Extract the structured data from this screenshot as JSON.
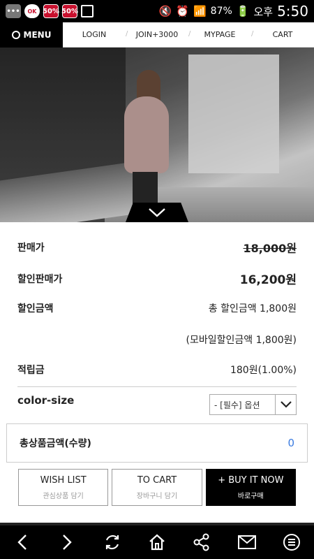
{
  "status_bar": {
    "icons": [
      "message-icon",
      "ok-app-icon",
      "sale-badge-icon",
      "sale-badge-icon",
      "clipboard-check-icon"
    ],
    "ok_label": "OK",
    "sale1": "50%",
    "sale2": "50%",
    "battery": "87%",
    "ampm": "오후",
    "time": "5:50"
  },
  "nav": {
    "menu": "MENU",
    "links": [
      "LOGIN",
      "JOIN+3000",
      "MYPAGE",
      "CART"
    ]
  },
  "product": {
    "rows": [
      {
        "label": "판매가",
        "value": "18,000원"
      },
      {
        "label": "할인판매가",
        "value": "16,200원"
      },
      {
        "label": "할인금액",
        "value": "총 할인금액 1,800원"
      },
      {
        "label": "",
        "value": "(모바일할인금액 1,800원)"
      },
      {
        "label": "적립금",
        "value": "180원(1.00%)"
      }
    ],
    "option_label": "color-size",
    "option_selected": "- [필수] 옵션",
    "total_label": "총상품금액(수량)",
    "total_value": "0"
  },
  "buttons": [
    {
      "main": "WISH LIST",
      "sub": "관심상품 담기"
    },
    {
      "main": "TO CART",
      "sub": "장바구니 담기"
    },
    {
      "main": "+ BUY IT NOW",
      "sub": "바로구매"
    }
  ],
  "colors": {
    "accent_blue": "#3a7be0",
    "black": "#000000"
  }
}
